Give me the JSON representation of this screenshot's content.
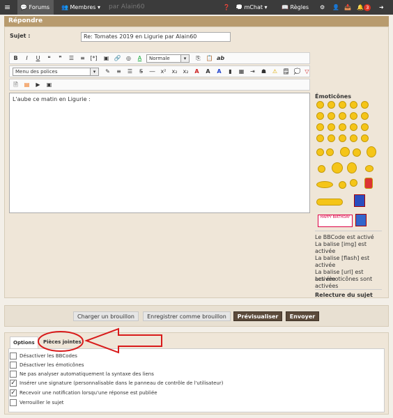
{
  "navbar": {
    "menu_icon": "hamburger-icon",
    "forums_label": "Forums",
    "membres_label": "Membres ▾",
    "ghost_text": "par Alain60",
    "help_icon": "question-icon",
    "chat_label": "mChat ▾",
    "rules_label": "Règles",
    "notif_count": "3"
  },
  "reply": {
    "title": "Répondre",
    "subject_label": "Sujet :",
    "subject_value": "Re: Tomates 2019 en Ligurie par Alain60"
  },
  "toolbar": {
    "size_select": "Normale",
    "font_select": "Menu des polices"
  },
  "editor": {
    "text": "L'aube ce matin en Ligurie :"
  },
  "emoticons": {
    "title": "Émoticônes",
    "birthday_text": "HAPPY BIRTHDAY"
  },
  "rules": {
    "bbcode": "Le BBCode est activé",
    "img": "La balise [img] est activée",
    "flash": "La balise [flash] est activée",
    "url": "La balise [url] est activée",
    "emoticons": "Les émoticônes sont activées",
    "review": "Relecture du sujet"
  },
  "buttons": {
    "load_draft": "Charger un brouillon",
    "save_draft": "Enregistrer comme brouillon",
    "preview": "Prévisualiser",
    "send": "Envoyer"
  },
  "tabs": {
    "options": "Options",
    "attachments": "Pièces jointes"
  },
  "options": [
    {
      "label": "Désactiver les BBCodes",
      "checked": false
    },
    {
      "label": "Désactiver les émoticônes",
      "checked": false
    },
    {
      "label": "Ne pas analyser automatiquement la syntaxe des liens",
      "checked": false
    },
    {
      "label": "Insérer une signature (personnalisable dans le panneau de contrôle de l'utilisateur)",
      "checked": true
    },
    {
      "label": "Recevoir une notification lorsqu'une réponse est publiée",
      "checked": true
    },
    {
      "label": "Verrouiller le sujet",
      "checked": false
    }
  ],
  "annotation": {
    "circle_color": "#d81a1a",
    "arrow_color": "#d81a1a"
  },
  "colors": {
    "header_bar": "#b89b6e",
    "primary_button": "#5b4a3a",
    "navbar": "#3b3b3b"
  }
}
